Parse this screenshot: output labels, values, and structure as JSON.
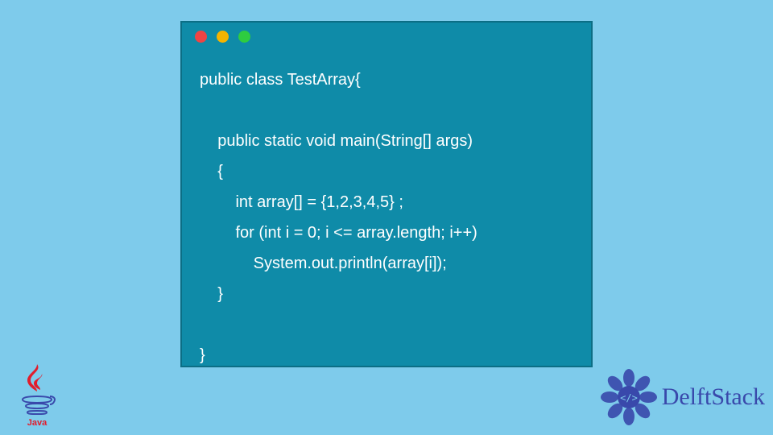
{
  "code": {
    "lines": [
      "public class TestArray{",
      "",
      "    public static void main(String[] args)",
      "    {",
      "        int array[] = {1,2,3,4,5} ;",
      "        for (int i = 0; i <= array.length; i++)",
      "            System.out.println(array[i]);",
      "    }",
      "",
      "}"
    ]
  },
  "window": {
    "dot_colors": {
      "red": "#ef4444",
      "yellow": "#f5b400",
      "green": "#2ecc40"
    }
  },
  "branding": {
    "java_label": "Java",
    "delft_label": "DelftStack"
  },
  "colors": {
    "page_bg": "#7ecbeb",
    "window_bg": "#0f8ba8",
    "window_border": "#0c6e85",
    "code_text": "#ffffff",
    "delft_blue": "#3949ab"
  }
}
